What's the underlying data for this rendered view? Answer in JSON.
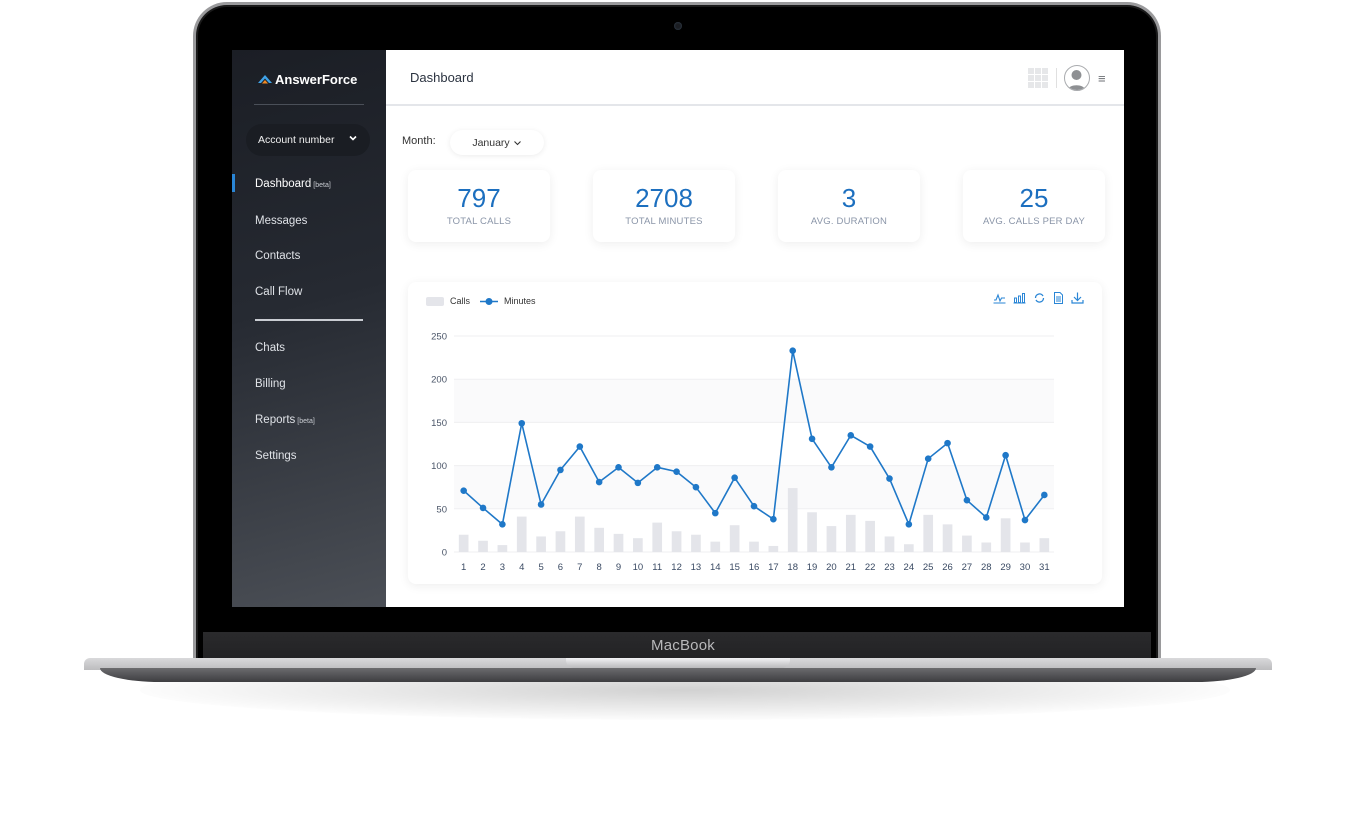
{
  "device": {
    "brand_label": "MacBook"
  },
  "app": {
    "name": "AnswerForce"
  },
  "sidebar": {
    "account_selector": {
      "label": "Account number",
      "icon": "chevron-down-icon"
    },
    "items": [
      {
        "label": "Dashboard",
        "tag": "[beta]",
        "active": true
      },
      {
        "label": "Messages",
        "tag": ""
      },
      {
        "label": "Contacts",
        "tag": ""
      },
      {
        "label": "Call Flow",
        "tag": ""
      },
      {
        "label": "Chats",
        "tag": ""
      },
      {
        "label": "Billing",
        "tag": ""
      },
      {
        "label": "Reports",
        "tag": "[beta]"
      },
      {
        "label": "Settings",
        "tag": ""
      }
    ]
  },
  "header": {
    "title": "Dashboard",
    "icons": [
      "apps-grid-icon",
      "user-avatar-icon",
      "hamburger-menu-icon"
    ],
    "menu_glyph": "≡"
  },
  "filters": {
    "month_label": "Month:",
    "month_value": "January",
    "month_chevron": "⌄"
  },
  "stats": [
    {
      "value": "797",
      "label": "TOTAL CALLS"
    },
    {
      "value": "2708",
      "label": "TOTAL MINUTES"
    },
    {
      "value": "3",
      "label": "AVG. DURATION"
    },
    {
      "value": "25",
      "label": "AVG. CALLS PER DAY"
    }
  ],
  "colors": {
    "accent": "#1c6fbf",
    "line": "#1f78c8",
    "bar": "#e4e5ea",
    "sidebar_active": "#2a86d6"
  },
  "chart_toolbox": [
    "line-chart-icon",
    "bar-chart-icon",
    "refresh-icon",
    "data-view-icon",
    "download-icon"
  ],
  "chart_data": {
    "type": "bar",
    "title": "",
    "xlabel": "",
    "ylabel": "",
    "ylim": [
      0,
      250
    ],
    "yticks": [
      0,
      50,
      100,
      150,
      200,
      250
    ],
    "grid": true,
    "legend_position": "top-left",
    "categories": [
      "1",
      "2",
      "3",
      "4",
      "5",
      "6",
      "7",
      "8",
      "9",
      "10",
      "11",
      "12",
      "13",
      "14",
      "15",
      "16",
      "17",
      "18",
      "19",
      "20",
      "21",
      "22",
      "23",
      "24",
      "25",
      "26",
      "27",
      "28",
      "29",
      "30",
      "31"
    ],
    "series": [
      {
        "name": "Calls",
        "type": "bar",
        "values": [
          20,
          13,
          8,
          41,
          18,
          24,
          41,
          28,
          21,
          16,
          34,
          24,
          20,
          12,
          31,
          12,
          7,
          74,
          46,
          30,
          43,
          36,
          18,
          9,
          43,
          32,
          19,
          11,
          39,
          11,
          16
        ]
      },
      {
        "name": "Minutes",
        "type": "line",
        "values": [
          71,
          51,
          32,
          149,
          55,
          95,
          122,
          81,
          98,
          80,
          98,
          93,
          75,
          45,
          86,
          53,
          38,
          233,
          131,
          98,
          135,
          122,
          85,
          32,
          108,
          126,
          60,
          40,
          112,
          37,
          66
        ]
      }
    ]
  }
}
